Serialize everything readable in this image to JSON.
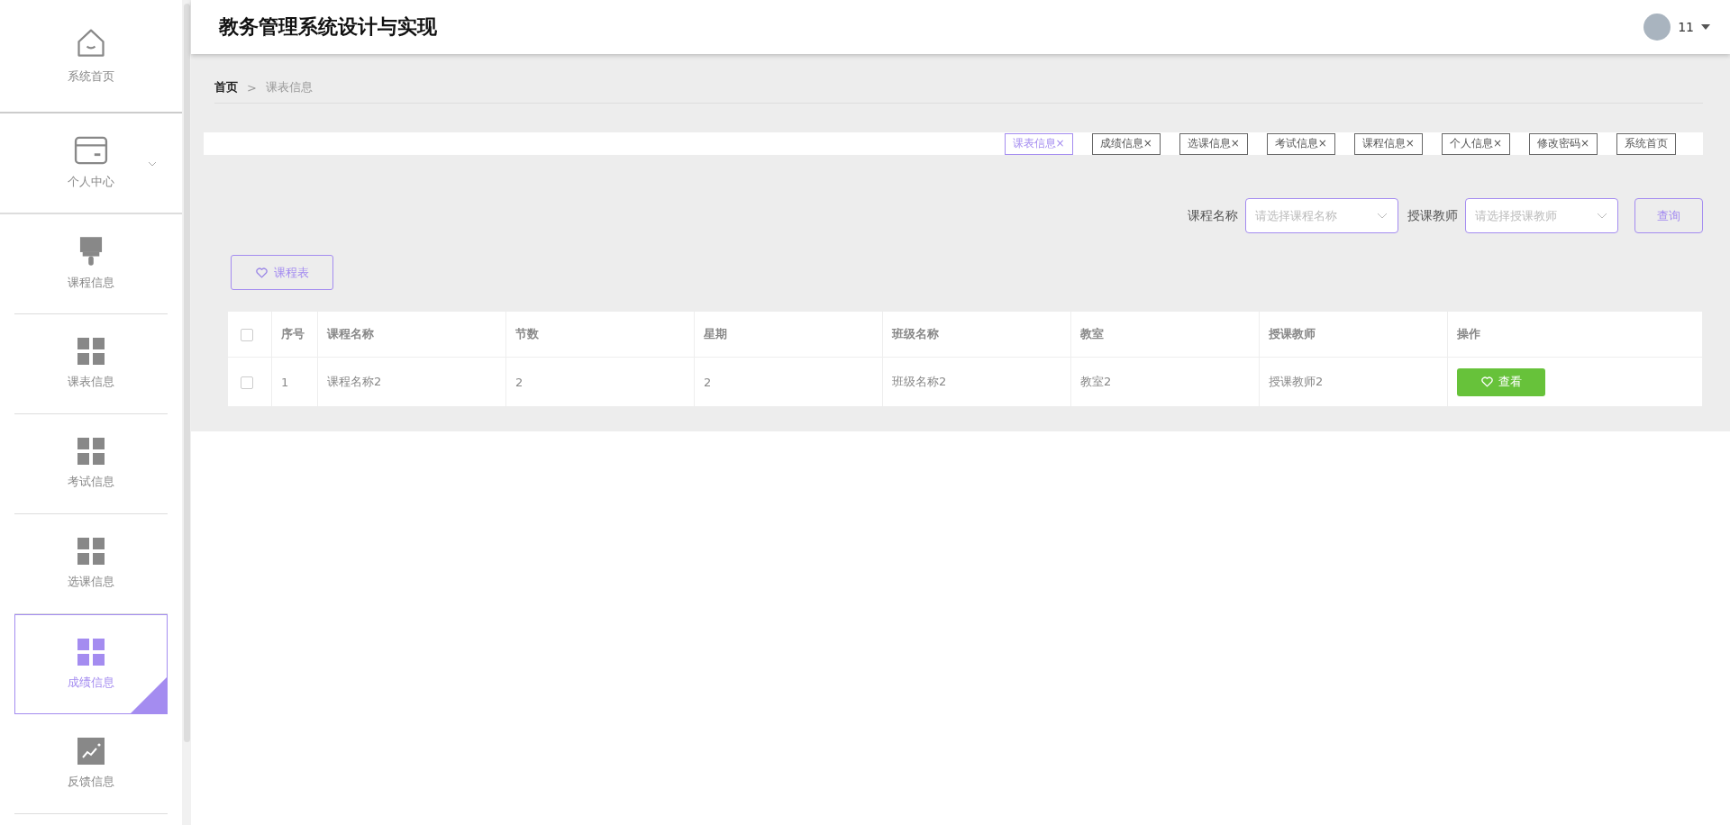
{
  "sidebar": {
    "items": [
      {
        "label": "系统首页",
        "kind": "home",
        "selected": false,
        "has_submenu": false
      },
      {
        "label": "个人中心",
        "kind": "card",
        "selected": false,
        "has_submenu": true
      },
      {
        "label": "课程信息",
        "kind": "brush",
        "selected": false,
        "has_submenu": false
      },
      {
        "label": "课表信息",
        "kind": "grid",
        "selected": false,
        "has_submenu": false
      },
      {
        "label": "考试信息",
        "kind": "grid",
        "selected": false,
        "has_submenu": false
      },
      {
        "label": "选课信息",
        "kind": "grid",
        "selected": false,
        "has_submenu": false
      },
      {
        "label": "成绩信息",
        "kind": "grid",
        "selected": true,
        "has_submenu": false
      },
      {
        "label": "反馈信息",
        "kind": "chart",
        "selected": false,
        "has_submenu": false
      }
    ]
  },
  "header": {
    "title": "教务管理系统设计与实现",
    "user": "11"
  },
  "breadcrumb": [
    "首页",
    "课表信息"
  ],
  "breadcrumb_separator": ">",
  "tabs": [
    {
      "label": "课表信息",
      "selected": true,
      "closable": true
    },
    {
      "label": "成绩信息",
      "selected": false,
      "closable": true
    },
    {
      "label": "选课信息",
      "selected": false,
      "closable": true
    },
    {
      "label": "考试信息",
      "selected": false,
      "closable": true
    },
    {
      "label": "课程信息",
      "selected": false,
      "closable": true
    },
    {
      "label": "个人信息",
      "selected": false,
      "closable": true
    },
    {
      "label": "修改密码",
      "selected": false,
      "closable": true
    },
    {
      "label": "系统首页",
      "selected": false,
      "closable": false
    }
  ],
  "close_mark": "×",
  "filters": [
    {
      "label": "课程名称",
      "placeholder": "请选择课程名称"
    },
    {
      "label": "授课教师",
      "placeholder": "请选择授课教师"
    }
  ],
  "search_button": "查询",
  "schedule_button": "课程表",
  "table": {
    "select_all_checked": false,
    "columns": [
      "序号",
      "课程名称",
      "节数",
      "星期",
      "班级名称",
      "教室",
      "授课教师",
      "操作"
    ],
    "rows": [
      {
        "checked": false,
        "cells": [
          "1",
          "课程名称2",
          "2",
          "2",
          "班级名称2",
          "教室2",
          "授课教师2"
        ],
        "action": "查看"
      }
    ]
  }
}
